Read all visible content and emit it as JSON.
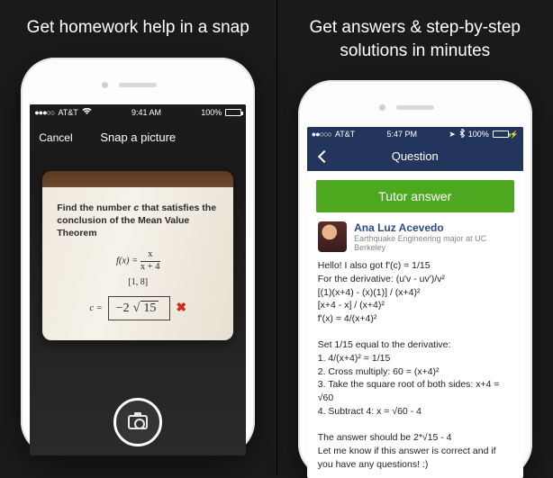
{
  "left": {
    "headline": "Get homework help\nin a snap",
    "status": {
      "carrier": "AT&T",
      "time": "9:41 AM",
      "battery": "100%"
    },
    "nav": {
      "cancel": "Cancel",
      "title": "Snap a picture"
    },
    "problem_line1": "Find the number",
    "problem_var": "c",
    "problem_line2": "that satisfies the",
    "problem_line3": "conclusion of the Mean Value Theorem",
    "fx_label": "f(x) =",
    "frac_num": "x",
    "frac_den": "x + 4",
    "interval": "[1, 8]",
    "c_label": "c =",
    "ans_prefix": "−2",
    "ans_root_index": "",
    "ans_radicand": "15"
  },
  "right": {
    "headline": "Get answers & step-by-step\nsolutions in minutes",
    "status": {
      "carrier": "AT&T",
      "time": "5:47 PM",
      "battery": "100%"
    },
    "nav": {
      "title": "Question"
    },
    "banner": "Tutor answer",
    "tutor": {
      "name": "Ana Luz Acevedo",
      "sub": "Earthquake Engineering major at UC Berkeley"
    },
    "body": "Hello! I also got f'(c) = 1/15\nFor the derivative: (u'v - uv')/v²\n[(1)(x+4) - (x)(1)] / (x+4)²\n[x+4 - x] / (x+4)²\nf'(x) = 4/(x+4)²\n\nSet 1/15 equal to the derivative:\n1. 4/(x+4)² = 1/15\n2. Cross multiply: 60 = (x+4)²\n3. Take the square root of both sides: x+4 = √60\n4. Subtract 4: x = √60 - 4\n\nThe answer should be 2*√15 - 4\nLet me know if this answer is correct and if you have any questions! :)"
  }
}
